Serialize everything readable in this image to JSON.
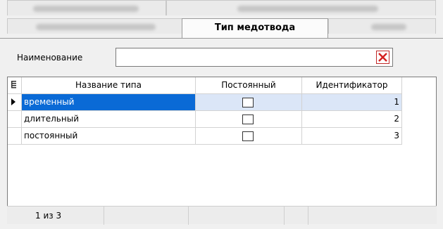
{
  "tabs": {
    "active_label": "Тип медотвода"
  },
  "filter": {
    "label": "Наименование",
    "value": "",
    "clear_icon": "red-x-close-icon"
  },
  "grid": {
    "columns": [
      "Название типа",
      "Постоянный",
      "Идентификатор"
    ],
    "rows": [
      {
        "name": "временный",
        "permanent": false,
        "id": "1",
        "selected": true
      },
      {
        "name": "длительный",
        "permanent": false,
        "id": "2",
        "selected": false
      },
      {
        "name": "постоянный",
        "permanent": false,
        "id": "3",
        "selected": false
      }
    ]
  },
  "status": {
    "record_position": "1 из 3"
  },
  "colors": {
    "selection": "#0a6ad6",
    "selection_light": "#dbe6f7",
    "clear_icon": "#d41f1f"
  }
}
